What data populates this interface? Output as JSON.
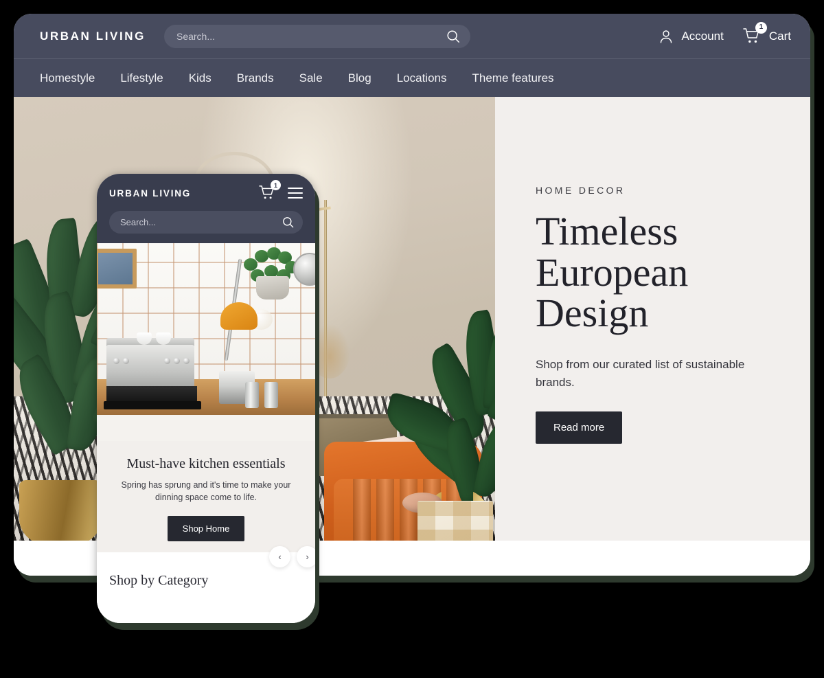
{
  "desktop": {
    "brand": "URBAN LIVING",
    "search": {
      "placeholder": "Search...",
      "icon": "search-icon"
    },
    "account": {
      "label": "Account",
      "icon": "user-icon"
    },
    "cart": {
      "label": "Cart",
      "icon": "cart-icon",
      "badge": "1"
    },
    "nav": [
      {
        "label": "Homestyle"
      },
      {
        "label": "Lifestyle"
      },
      {
        "label": "Kids"
      },
      {
        "label": "Brands"
      },
      {
        "label": "Sale"
      },
      {
        "label": "Blog"
      },
      {
        "label": "Locations"
      },
      {
        "label": "Theme features"
      }
    ],
    "hero": {
      "eyebrow": "HOME DECOR",
      "title": "Timeless European Design",
      "subtitle": "Shop from our curated list of sustainable brands.",
      "cta": "Read more",
      "photo_alt": "living room with orange armchair, plants and patterned rug"
    }
  },
  "phone": {
    "brand": "URBAN LIVING",
    "cart": {
      "icon": "cart-icon",
      "badge": "1"
    },
    "menu": {
      "icon": "hamburger-menu-icon"
    },
    "search": {
      "placeholder": "Search...",
      "icon": "search-icon"
    },
    "photo_alt": "kitchen counter with espresso machine, grinder and lamp",
    "card": {
      "title": "Must-have kitchen essentials",
      "body": "Spring has sprung and it's time to make your dinning space come to life.",
      "cta": "Shop Home"
    },
    "carousel": {
      "prev": "‹",
      "next": "›"
    },
    "section_title": "Shop by Category"
  },
  "colors": {
    "header_dark": "#474b5e",
    "phone_header_dark": "#393d4e",
    "panel_bg": "#f2efed",
    "button_dark": "#262830",
    "page_bg": "#000000",
    "shadow_green": "#2e3a2e",
    "accent_orange": "#d5621c"
  }
}
